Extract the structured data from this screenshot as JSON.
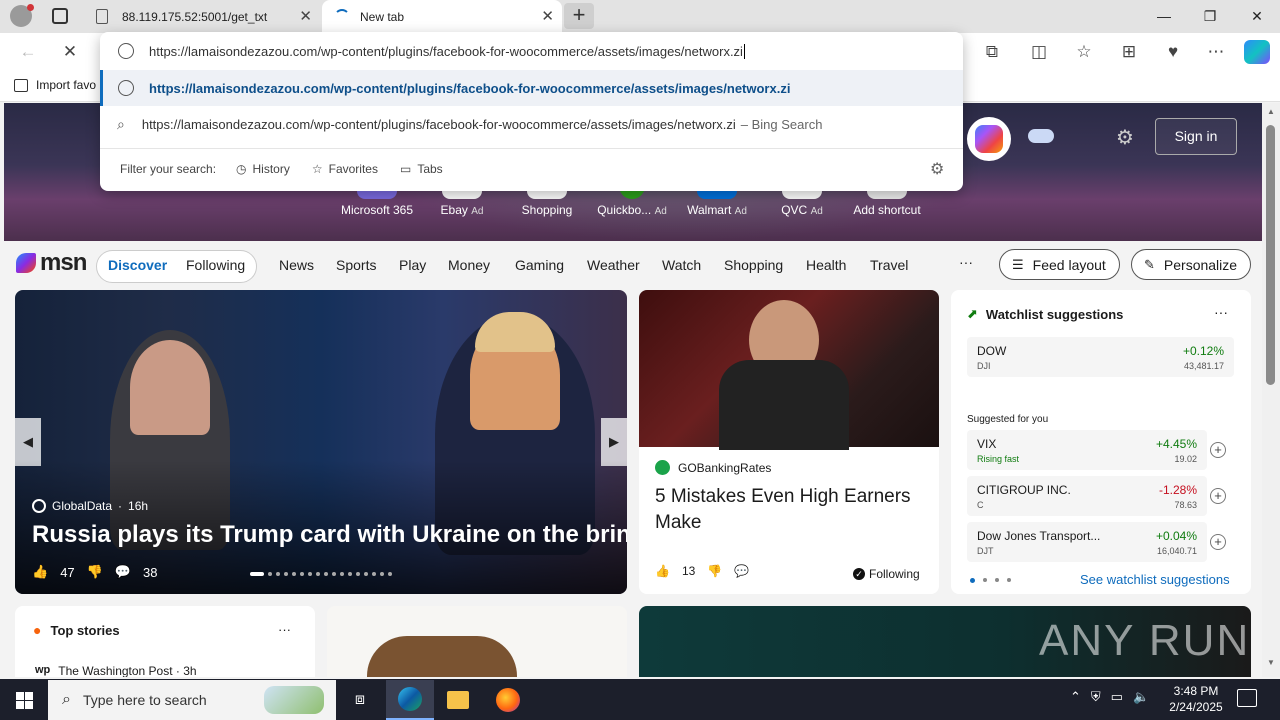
{
  "tabs": [
    {
      "title": "88.119.175.52:5001/get_txt"
    },
    {
      "title": "New tab"
    }
  ],
  "address_bar": {
    "url_value": "https://lamaisondezazou.com/wp-content/plugins/facebook-for-woocommerce/assets/images/networx.zi"
  },
  "suggestions": {
    "url": "https://lamaisondezazou.com/wp-content/plugins/facebook-for-woocommerce/assets/images/networx.zi",
    "bing_query": "https://lamaisondezazou.com/wp-content/plugins/facebook-for-woocommerce/assets/images/networx.zi",
    "bing_suffix": "– Bing Search",
    "filter_label": "Filter your search:",
    "filters": [
      "History",
      "Favorites",
      "Tabs"
    ]
  },
  "favorites_bar": {
    "import_label": "Import favo"
  },
  "hero": {
    "signin": "Sign in",
    "shortcuts": [
      {
        "label": "Microsoft 365",
        "ad": ""
      },
      {
        "label": "Ebay",
        "ad": "Ad"
      },
      {
        "label": "Shopping",
        "ad": ""
      },
      {
        "label": "Quickbo...",
        "ad": "Ad"
      },
      {
        "label": "Walmart",
        "ad": "Ad"
      },
      {
        "label": "QVC",
        "ad": "Ad"
      },
      {
        "label": "Add shortcut",
        "ad": ""
      }
    ]
  },
  "msn_nav": {
    "logo": "msn",
    "discover": "Discover",
    "following": "Following",
    "items": [
      "News",
      "Sports",
      "Play",
      "Money",
      "Gaming",
      "Weather",
      "Watch",
      "Shopping",
      "Health",
      "Travel"
    ],
    "more": "···",
    "feed_layout": "Feed layout",
    "personalize": "Personalize"
  },
  "main_story": {
    "source": "GlobalData",
    "age": "16h",
    "headline": "Russia plays its Trump card with Ukraine on the brink",
    "likes": "47",
    "comments": "38"
  },
  "mid_story": {
    "source": "GOBankingRates",
    "headline": "5 Mistakes Even High Earners Make",
    "likes": "13",
    "following": "Following"
  },
  "watchlist": {
    "title": "Watchlist suggestions",
    "main": {
      "name": "DOW",
      "symbol": "DJI",
      "change": "+0.12%",
      "price": "43,481.17"
    },
    "suggested_label": "Suggested for you",
    "suggested": [
      {
        "name": "VIX",
        "symbol": "Rising fast",
        "change": "+4.45%",
        "price": "19.02",
        "color": "#107c10"
      },
      {
        "name": "CITIGROUP INC.",
        "symbol": "C",
        "change": "-1.28%",
        "price": "78.63",
        "color": "#c50f1f"
      },
      {
        "name": "Dow Jones Transport...",
        "symbol": "DJT",
        "change": "+0.04%",
        "price": "16,040.71",
        "color": "#107c10"
      }
    ],
    "see_more": "See watchlist suggestions"
  },
  "top_stories": {
    "title": "Top stories",
    "source": "The Washington Post · 3h"
  },
  "watermark": "ANY RUN",
  "taskbar": {
    "search_placeholder": "Type here to search",
    "time": "3:48 PM",
    "date": "2/24/2025"
  },
  "colors": {
    "accent": "#0f6cbd",
    "positive": "#107c10",
    "negative": "#c50f1f"
  }
}
